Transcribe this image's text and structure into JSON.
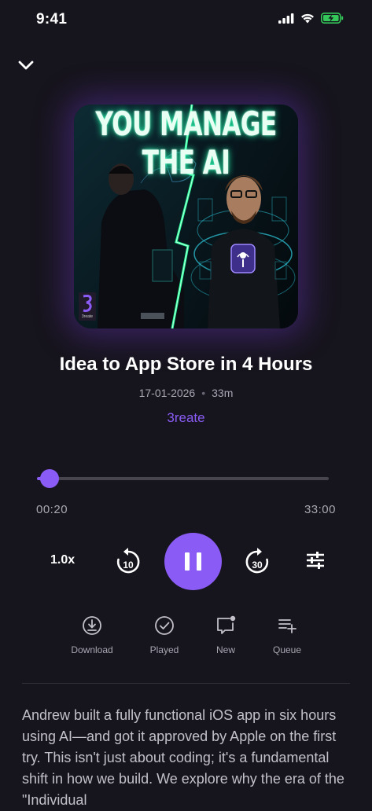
{
  "status_bar": {
    "time": "9:41"
  },
  "episode": {
    "artwork_headline": "YOU MANAGE THE AI",
    "artwork_badge": "3reate",
    "title": "Idea to App Store in 4 Hours",
    "date": "17-01-2026",
    "duration": "33m",
    "podcast": "3reate"
  },
  "player": {
    "current_time": "00:20",
    "total_time": "33:00",
    "progress": 0.01,
    "speed": "1.0x",
    "rewind_seconds": "10",
    "forward_seconds": "30"
  },
  "actions": [
    {
      "label": "Download"
    },
    {
      "label": "Played"
    },
    {
      "label": "New"
    },
    {
      "label": "Queue"
    }
  ],
  "description": "Andrew built a fully functional iOS app in six hours using AI—and got it approved by Apple on the first try. This isn't just about coding; it's a fundamental shift in how we build. We explore why the era of the \"Individual",
  "colors": {
    "accent": "#8a5cf5",
    "background": "#16141c",
    "battery": "#34c759"
  }
}
